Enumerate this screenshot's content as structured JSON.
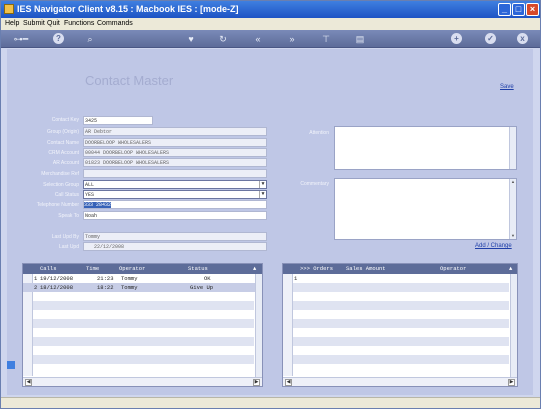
{
  "window": {
    "title": "IES Navigator Client v8.15 :  Macbook IES :      [mode-Z]"
  },
  "menu": [
    "Help",
    "Submit",
    "Quit",
    "Functions",
    "Commands"
  ],
  "toolbar": {
    "icons": [
      "key-icon",
      "help-icon",
      "search-icon",
      "heart-icon",
      "refresh-icon",
      "rewind-icon",
      "fast-forward-icon",
      "filter-icon",
      "document-icon",
      "add-icon",
      "check-icon",
      "close-icon"
    ],
    "help_glyph": "?",
    "add_glyph": "+",
    "check_glyph": "✓",
    "close_glyph": "x",
    "search_glyph": "⌕"
  },
  "page": {
    "heading": "Contact Master",
    "save_label": "Save",
    "add_change_label": "Add / Change"
  },
  "form": {
    "contact_key": {
      "label": "Contact Key",
      "value": "3425"
    },
    "group": {
      "label": "Group (Origin)",
      "value": "AR Debtor"
    },
    "contact_name": {
      "label": "Contact Name",
      "value": "DOORBELOOP WHOLESALERS"
    },
    "crm_account": {
      "label": "CRM Account",
      "value": "00044 DOORBELOOP WHOLESALERS"
    },
    "ar_account": {
      "label": "AR Account",
      "value": "01823 DOORBELOOP WHOLESALERS"
    },
    "merchandise_ref": {
      "label": "Merchandise Ref",
      "value": ""
    },
    "selection_group": {
      "label": "Selection Group",
      "value": "ALL"
    },
    "call_status": {
      "label": "Call Status",
      "value": "YES"
    },
    "telephone": {
      "label": "Telephone Number",
      "value": "333 28432"
    },
    "speak_to": {
      "label": "Speak To",
      "value": "Noah"
    },
    "last_user": {
      "label": "Last Upd By",
      "value": "Tommy"
    },
    "last_date": {
      "label": "Last Upd",
      "value": "22/12/2008"
    },
    "attention": {
      "label": "Attention",
      "value": ""
    },
    "commentary": {
      "label": "Commentary",
      "value": ""
    }
  },
  "calls": {
    "headers": [
      "Calls",
      "Time",
      "Operator",
      "Status"
    ],
    "rows": [
      {
        "num": "1",
        "date": "19/12/2008",
        "time": "21:23",
        "operator": "Tommy",
        "status": "OK"
      },
      {
        "num": "2",
        "date": "18/12/2008",
        "time": "18:22",
        "operator": "Tommy",
        "status": "Give Up"
      }
    ]
  },
  "orders": {
    "headers": [
      ">>> Orders",
      "Sales Amount",
      "Operator"
    ],
    "rows": [
      {
        "num": "1",
        "orders": "",
        "amount": "",
        "operator": ""
      }
    ]
  }
}
